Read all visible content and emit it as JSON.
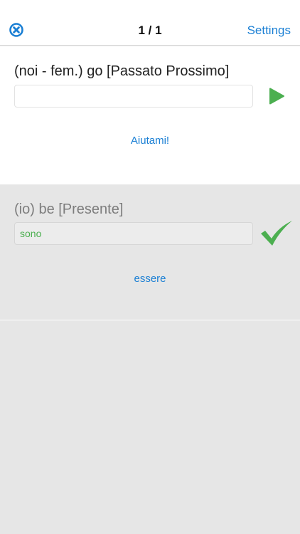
{
  "navbar": {
    "counter": "1 / 1",
    "settings_label": "Settings",
    "close_icon": "close-circle-icon"
  },
  "current_question": {
    "prompt": "(noi - fem.) go [Passato Prossimo]",
    "answer_value": "",
    "answer_placeholder": "",
    "submit_icon": "play-icon",
    "help_label": "Aiutami!"
  },
  "previous_question": {
    "prompt": "(io) be [Presente]",
    "answer_value": "sono",
    "result_icon": "checkmark-icon",
    "infinitive_label": "essere"
  },
  "colors": {
    "accent": "#1a7fd4",
    "correct": "#4caf50",
    "background": "#e6e6e6"
  }
}
